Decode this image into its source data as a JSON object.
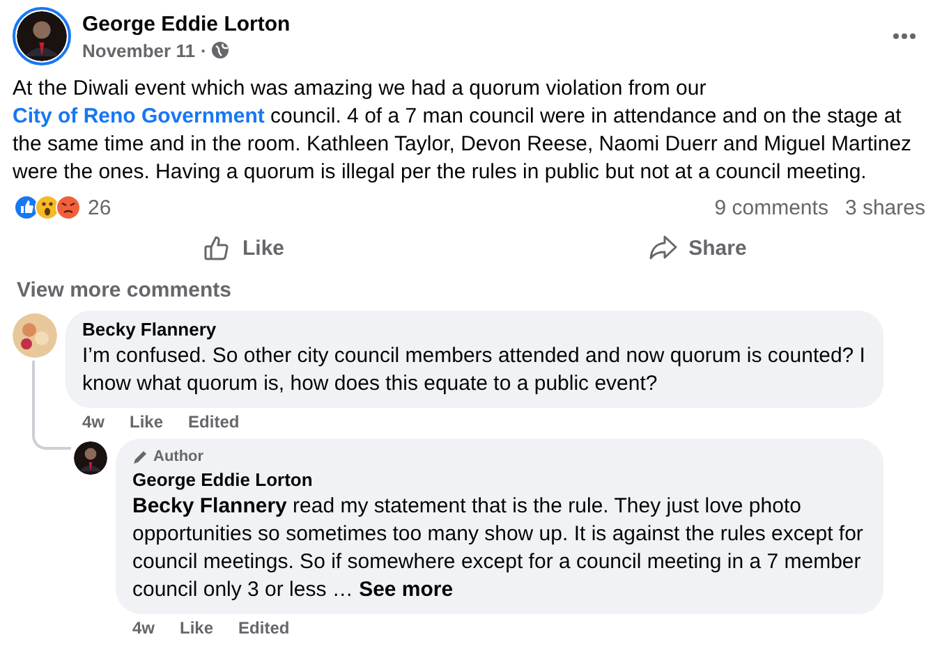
{
  "post": {
    "author": "George Eddie Lorton",
    "date": "November 11",
    "date_separator": "·",
    "text_before_link": "At the Diwali event which was amazing we had a quorum violation from our",
    "link": "City of Reno Government",
    "text_after_link": "council. 4 of a 7 man council were in attendance and on the stage at the same time and in the room. Kathleen Taylor, Devon Reese, Naomi Duerr and Miguel Martinez were the ones. Having a quorum is illegal per the rules in public but not at a council meeting.",
    "reaction_count": "26",
    "comment_count": "9 comments",
    "share_count": "3 shares",
    "actions": [
      {
        "kind": "like",
        "label": "Like"
      },
      {
        "kind": "share",
        "label": "Share"
      }
    ]
  },
  "view_more": "View more comments",
  "comments": [
    {
      "kind": "comment",
      "author": "Becky Flannery",
      "text": "I’m confused. So other city council members attended and now quorum is counted? I know what quorum is, how does this equate to a public event?",
      "meta": [
        "4w",
        "Like",
        "Edited"
      ]
    },
    {
      "kind": "reply",
      "badge": "Author",
      "author": "George Eddie Lorton",
      "text": "**Becky Flannery** read my statement that is the rule. They just love photo opportunities so sometimes too many show up. It is against the rules except for council meetings. So if somewhere except for a council meeting in a 7 member council only 3 or less …",
      "see_more": "See more",
      "meta": [
        "4w",
        "Like",
        "Edited"
      ]
    }
  ]
}
